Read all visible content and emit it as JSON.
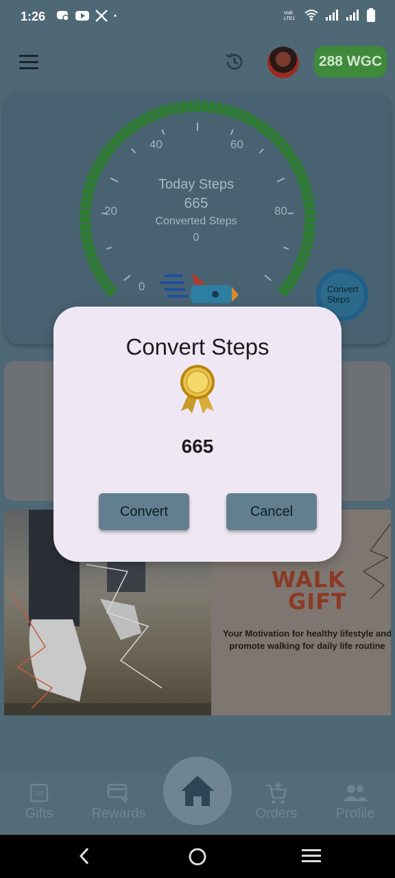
{
  "status_bar": {
    "time": "1:26"
  },
  "app_bar": {
    "wgc_balance": "288 WGC"
  },
  "gauge": {
    "today_label": "Today Steps",
    "today_value": "665",
    "converted_label": "Converted Steps",
    "converted_value": "0",
    "tick_labels": [
      "0",
      "20",
      "40",
      "60",
      "80"
    ],
    "convert_button_label": "Convert Steps",
    "progress_color": "#2f7d33"
  },
  "banner": {
    "title_line1": "WALK",
    "title_line2": "GIFT",
    "subtitle": "Your Motivation for healthy lifestyle and promote walking for daily life routine"
  },
  "dialog": {
    "title": "Convert Steps",
    "value": "665",
    "convert_label": "Convert",
    "cancel_label": "Cancel",
    "icon": "medal-icon"
  },
  "bottom_nav": {
    "items": [
      {
        "label": "Gifts",
        "icon": "gif-icon"
      },
      {
        "label": "Rewards",
        "icon": "card-plus-icon"
      },
      {
        "label": "Orders",
        "icon": "cart-plus-icon"
      },
      {
        "label": "Profile",
        "icon": "people-icon"
      }
    ],
    "home_icon": "home-icon"
  }
}
